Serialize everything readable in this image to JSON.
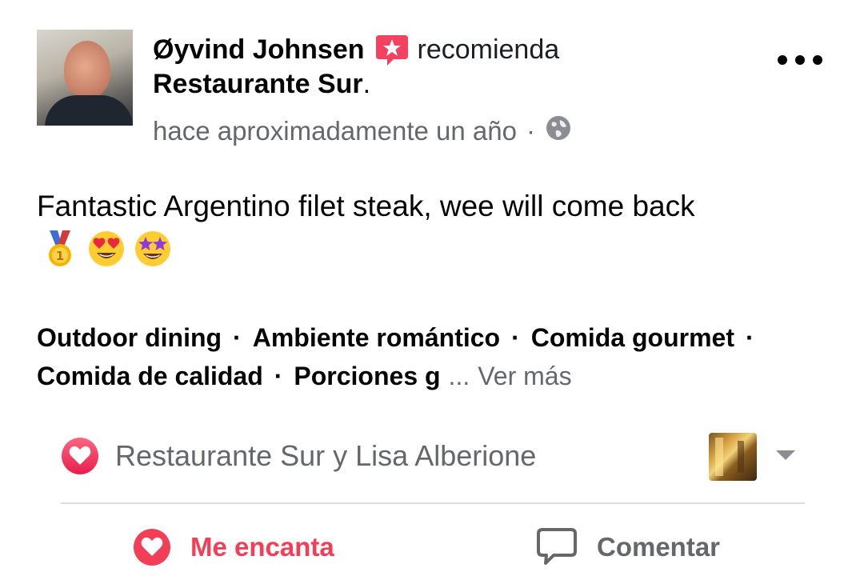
{
  "post": {
    "author_name": "Øyvind Johnsen",
    "recommend_verb": "recomienda",
    "place_name": "Restaurante Sur",
    "place_punct": ".",
    "time_text": "hace aproximadamente un año",
    "meta_separator": "·",
    "audience_icon": "globe-icon",
    "body_text": "Fantastic Argentino filet steak, wee will come back",
    "emojis": [
      "first-place-medal-emoji",
      "heart-eyes-emoji",
      "star-struck-emoji"
    ]
  },
  "tags": {
    "row1": [
      "Outdoor dining",
      "Ambiente romántico",
      "Comida gourmet"
    ],
    "row2": [
      "Comida de calidad",
      "Porciones g"
    ],
    "separator": "·",
    "ellipsis": "...",
    "see_more": "Ver más"
  },
  "reactions": {
    "icon": "heart-reaction-icon",
    "text": "Restaurante Sur y Lisa Alberione"
  },
  "actions": {
    "love_label": "Me encanta",
    "comment_label": "Comentar"
  },
  "colors": {
    "love": "#f33e58",
    "secondary_text": "#65676b",
    "divider": "#dadde1",
    "recommend_badge": "#f3425f"
  }
}
